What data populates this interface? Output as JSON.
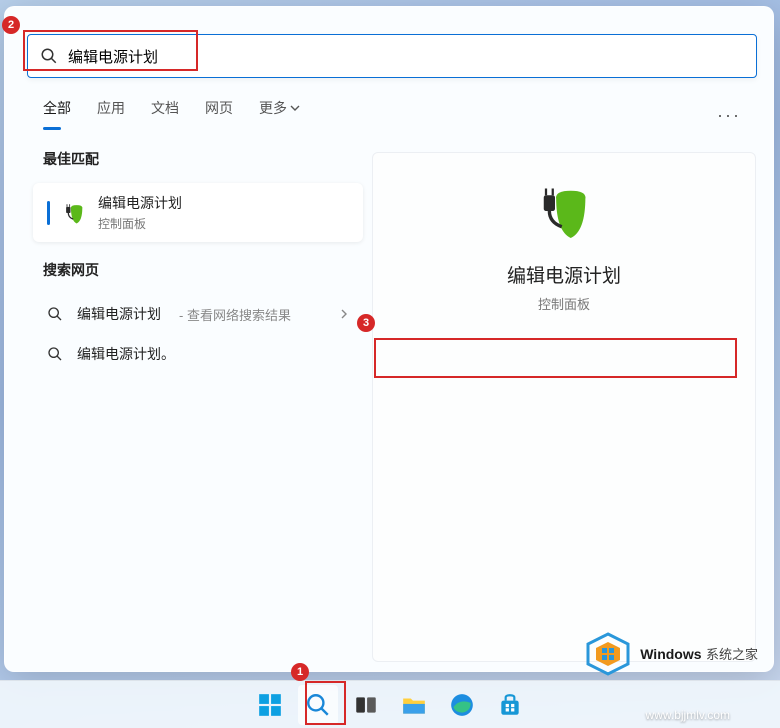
{
  "search": {
    "query": "编辑电源计划"
  },
  "tabs": {
    "all": "全部",
    "apps": "应用",
    "documents": "文档",
    "web": "网页",
    "more": "更多"
  },
  "sections": {
    "best_match": "最佳匹配",
    "search_web": "搜索网页"
  },
  "best_match": {
    "title": "编辑电源计划",
    "subtitle": "控制面板"
  },
  "web_results": [
    {
      "main": "编辑电源计划",
      "sub": "- 查看网络搜索结果",
      "has_chevron": true
    },
    {
      "main": "编辑电源计划。",
      "sub": "",
      "has_chevron": false
    }
  ],
  "detail": {
    "title": "编辑电源计划",
    "subtitle": "控制面板"
  },
  "callouts": {
    "1": "1",
    "2": "2",
    "3": "3"
  },
  "watermark": {
    "brand1": "Windows",
    "brand2": "系统之家",
    "url": "www.bjjmlv.com"
  }
}
